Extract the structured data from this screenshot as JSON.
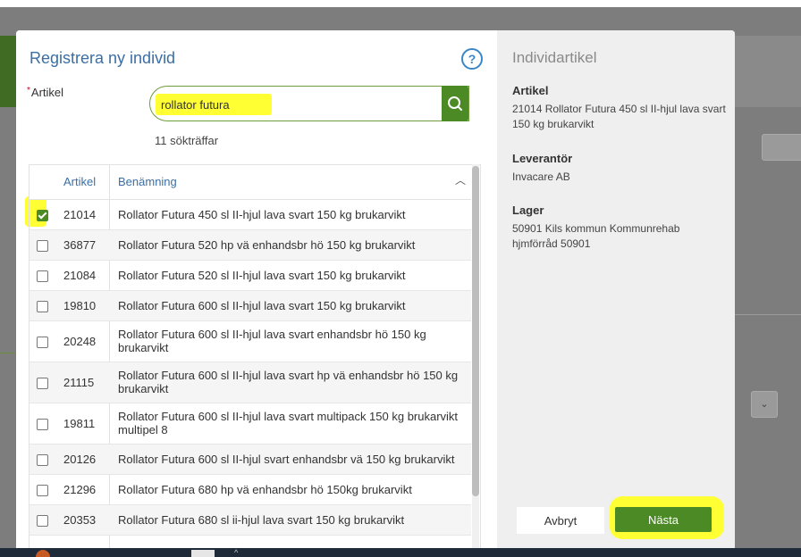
{
  "dialog": {
    "title": "Registrera ny individ",
    "artikel_label": "Artikel",
    "required_mark": "*",
    "search": {
      "value": "rollator futura"
    },
    "hits_text": "11 sökträffar",
    "table": {
      "columns": [
        "Artikel",
        "Benämning"
      ],
      "rows": [
        {
          "artikel": "21014",
          "name": "Rollator Futura 450 sl II-hjul lava svart 150 kg brukarvikt",
          "checked": true
        },
        {
          "artikel": "36877",
          "name": "Rollator Futura 520 hp vä enhandsbr hö 150 kg brukarvikt",
          "checked": false
        },
        {
          "artikel": "21084",
          "name": "Rollator Futura 520 sl II-hjul lava svart 150 kg brukarvikt",
          "checked": false
        },
        {
          "artikel": "19810",
          "name": "Rollator Futura 600 sl II-hjul lava svart 150 kg brukarvikt",
          "checked": false
        },
        {
          "artikel": "20248",
          "name": "Rollator Futura 600 sl II-hjul lava svart enhandsbr hö 150 kg brukarvikt",
          "checked": false
        },
        {
          "artikel": "21115",
          "name": "Rollator Futura 600 sl II-hjul lava svart hp vä enhandsbr hö 150 kg brukarvikt",
          "checked": false
        },
        {
          "artikel": "19811",
          "name": "Rollator Futura 600 sl II-hjul lava svart multipack 150 kg brukarvikt multipel 8",
          "checked": false
        },
        {
          "artikel": "20126",
          "name": "Rollator Futura 600 sl II-hjul svart enhandsbr vä 150 kg brukarvikt",
          "checked": false
        },
        {
          "artikel": "21296",
          "name": "Rollator Futura 680 hp vä enhandsbr hö 150kg brukarvikt",
          "checked": false
        },
        {
          "artikel": "20353",
          "name": "Rollator Futura 680 sl ii-hjul lava svart 150 kg brukarvikt",
          "checked": false
        }
      ]
    }
  },
  "panel": {
    "title": "Individartikel",
    "artikel_label": "Artikel",
    "artikel_value": "21014 Rollator Futura 450 sl II-hjul lava svart 150 kg brukarvikt",
    "leverantor_label": "Leverantör",
    "leverantor_value": "Invacare AB",
    "lager_label": "Lager",
    "lager_value": "50901 Kils kommun Kommunrehab hjmförråd 50901",
    "cancel_label": "Avbryt",
    "next_label": "Nästa"
  },
  "icons": {
    "help": "help-circle-icon",
    "search": "search-icon",
    "sort": "chevron-up-icon"
  },
  "colors": {
    "accent_green": "#4c8a25",
    "title_blue": "#3b6ea5",
    "highlight": "#ffff33"
  }
}
